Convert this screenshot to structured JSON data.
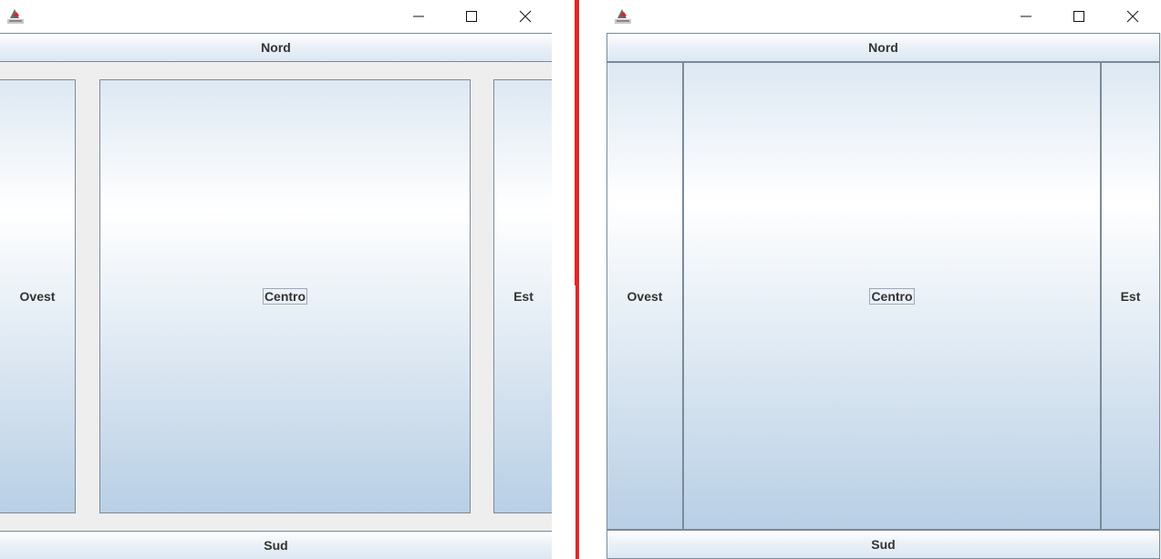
{
  "colors": {
    "divider": "#e3262b",
    "button_border": "#7a8a99",
    "button_gradient_top": "#dde8f3",
    "button_gradient_mid": "#ffffff",
    "button_gradient_bottom": "#b8cfe5",
    "panel_background": "#eeeeee",
    "text": "#333333"
  },
  "windows": {
    "left": {
      "title_icon": "java-app-icon",
      "controls": [
        "minimize-icon",
        "maximize-icon",
        "close-icon"
      ],
      "layout": {
        "north": "Nord",
        "south": "Sud",
        "west": "Ovest",
        "center": "Centro",
        "east": "Est"
      },
      "focused": "Centro"
    },
    "right": {
      "title_icon": "java-app-icon",
      "controls": [
        "minimize-icon",
        "maximize-icon",
        "close-icon"
      ],
      "layout": {
        "north": "Nord",
        "south": "Sud",
        "west": "Ovest",
        "center": "Centro",
        "east": "Est"
      },
      "focused": "Centro"
    }
  }
}
